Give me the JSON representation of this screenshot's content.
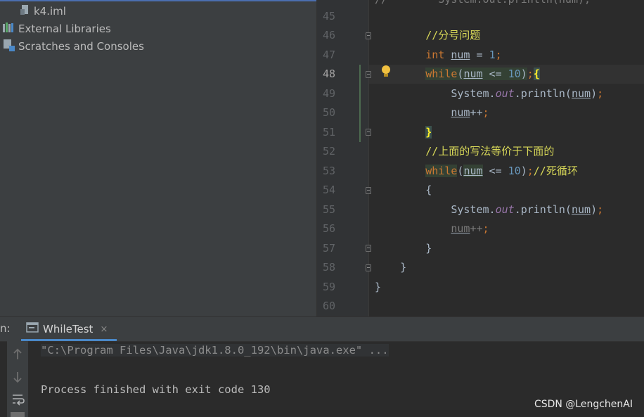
{
  "project_tree": {
    "items": [
      {
        "label": "k4.iml",
        "icon": "iml-file-icon"
      },
      {
        "label": "External Libraries",
        "icon": "libraries-icon"
      },
      {
        "label": "Scratches and Consoles",
        "icon": "scratches-icon"
      }
    ]
  },
  "editor": {
    "line_numbers": [
      "45",
      "46",
      "47",
      "48",
      "49",
      "50",
      "51",
      "52",
      "53",
      "54",
      "55",
      "56",
      "57",
      "58",
      "59",
      "60"
    ],
    "active_line": "48",
    "partial_top_line": "//        System.out.println(num);",
    "code": {
      "l46_comment": "//分号问题",
      "l47_type": "int",
      "l47_var": "num",
      "l47_eq": " = ",
      "l47_val": "1",
      "l47_semi": ";",
      "l48_kw": "while",
      "l48_open": "(",
      "l48_var": "num",
      "l48_op": " <= ",
      "l48_val": "10",
      "l48_close": ")",
      "l48_semi": ";",
      "l48_brace": "{",
      "l49_cls": "System.",
      "l49_fld": "out",
      "l49_call": ".println(",
      "l49_var": "num",
      "l49_close": ")",
      "l49_semi": ";",
      "l50_var": "num",
      "l50_op": "++",
      "l50_semi": ";",
      "l51_brace": "}",
      "l52_comment": "//上面的写法等价于下面的",
      "l53_kw": "while",
      "l53_open": "(",
      "l53_var": "num",
      "l53_op": " <= ",
      "l53_val": "10",
      "l53_close": ")",
      "l53_semi": ";",
      "l53_comment": "//死循环",
      "l54_brace": "{",
      "l55_cls": "System.",
      "l55_fld": "out",
      "l55_call": ".println(",
      "l55_var": "num",
      "l55_close": ")",
      "l55_semi": ";",
      "l56_var": "num",
      "l56_op": "++",
      "l56_semi": ";",
      "l57_brace": "}",
      "l58_brace": "}",
      "l59_brace": "}"
    }
  },
  "run_window": {
    "label": "n:",
    "tab_label": "WhileTest",
    "tab_close": "×",
    "command": "\"C:\\Program Files\\Java\\jdk1.8.0_192\\bin\\java.exe\" ...",
    "exit_message": "Process finished with exit code 130"
  },
  "watermark": "CSDN @LengchenAI",
  "colors": {
    "keyword": "#cc7832",
    "number": "#6897bb",
    "comment": "#d8d858",
    "field": "#9876aa",
    "tab_underline": "#4a88c7"
  }
}
